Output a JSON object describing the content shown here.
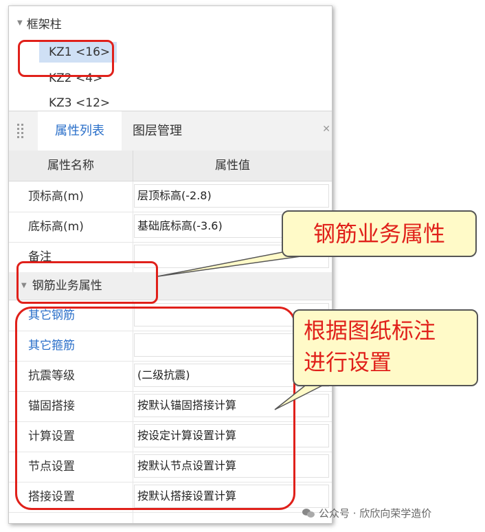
{
  "tree": {
    "root_label": "框架柱",
    "items": [
      {
        "label": "KZ1 <16>"
      },
      {
        "label": "KZ2 <4>"
      },
      {
        "label": "KZ3 <12>"
      }
    ]
  },
  "tabs": [
    {
      "label": "属性列表",
      "active": true
    },
    {
      "label": "图层管理",
      "active": false
    }
  ],
  "table": {
    "headers": [
      "属性名称",
      "属性值"
    ],
    "rows_top": [
      {
        "name": "顶标高(m)",
        "value": "层顶标高(-2.8)"
      },
      {
        "name": "底标高(m)",
        "value": "基础底标高(-3.6)"
      },
      {
        "name": "备注",
        "value": ""
      }
    ],
    "group_label": "钢筋业务属性",
    "rows_group": [
      {
        "name": "其它钢筋",
        "value": ""
      },
      {
        "name": "其它箍筋",
        "value": ""
      },
      {
        "name": "抗震等级",
        "value": "(二级抗震)"
      },
      {
        "name": "锚固搭接",
        "value": "按默认锚固搭接计算"
      },
      {
        "name": "计算设置",
        "value": "按设定计算设置计算"
      },
      {
        "name": "节点设置",
        "value": "按默认节点设置计算"
      },
      {
        "name": "搭接设置",
        "value": "按默认搭接设置计算"
      }
    ]
  },
  "callouts": {
    "first": "钢筋业务属性",
    "second_line1": "根据图纸标注",
    "second_line2": "进行设置"
  },
  "watermark": "公众号 · 欣欣向荣学造价",
  "colors": {
    "accent": "#2a6fc9",
    "annotation": "#e0201a",
    "callout_bg": "#fffac8"
  }
}
